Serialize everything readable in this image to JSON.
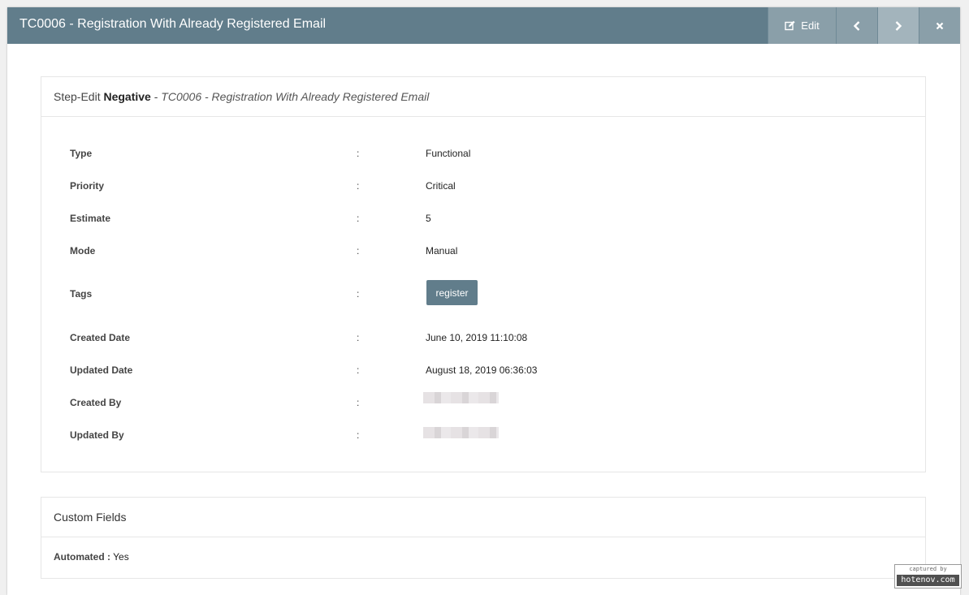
{
  "modal": {
    "title": "TC0006 - Registration With Already Registered Email",
    "actions": {
      "edit_label": "Edit"
    }
  },
  "detail_panel": {
    "heading_prefix": "Step-Edit",
    "heading_status": "Negative",
    "heading_separator": "-",
    "heading_testcase": "TC0006 - Registration With Already Registered Email",
    "colon": ":",
    "rows": {
      "type": {
        "label": "Type",
        "value": "Functional"
      },
      "priority": {
        "label": "Priority",
        "value": "Critical"
      },
      "estimate": {
        "label": "Estimate",
        "value": "5"
      },
      "mode": {
        "label": "Mode",
        "value": "Manual"
      },
      "tags": {
        "label": "Tags",
        "value": "register"
      },
      "created_date": {
        "label": "Created Date",
        "value": "June 10, 2019 11:10:08"
      },
      "updated_date": {
        "label": "Updated Date",
        "value": "August 18, 2019 06:36:03"
      },
      "created_by": {
        "label": "Created By"
      },
      "updated_by": {
        "label": "Updated By"
      }
    }
  },
  "custom_fields": {
    "heading": "Custom Fields",
    "automated_label": "Automated :",
    "automated_value": "Yes"
  },
  "watermark": {
    "line1": "captured by",
    "line2": "hotenov.com"
  },
  "colors": {
    "header_bg": "#617d8b",
    "header_button_bg": "#8a9fa9",
    "tag_bg": "#617d8b"
  }
}
